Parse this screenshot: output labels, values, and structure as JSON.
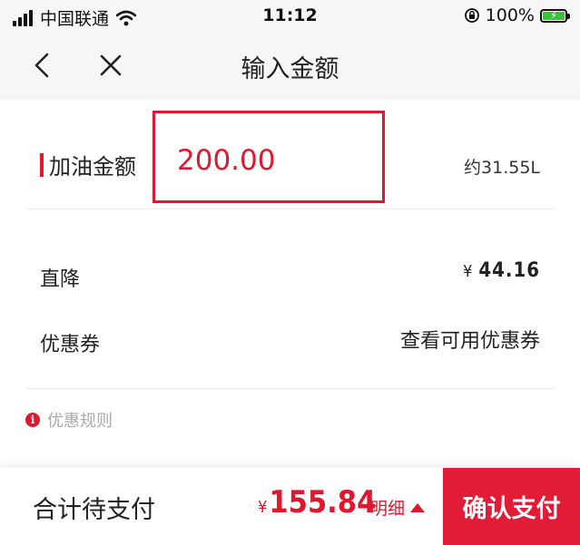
{
  "status_bar": {
    "carrier": "中国联通",
    "time": "11:12",
    "battery_percent": "100%",
    "battery_level": 1.0,
    "icons": [
      "signal-icon",
      "wifi-icon",
      "orientation-lock-icon",
      "battery-charging-icon"
    ]
  },
  "nav": {
    "title": "输入金额",
    "back_icon": "chevron-left-icon",
    "close_icon": "close-icon"
  },
  "amount": {
    "label": "加油金额",
    "value": "200.00",
    "litres": "约31.55L"
  },
  "discount": {
    "label": "直降",
    "currency": "¥",
    "value": "44.16"
  },
  "coupon": {
    "label": "优惠券",
    "action": "查看可用优惠券"
  },
  "rules": {
    "label": "优惠规则",
    "icon": "info-icon"
  },
  "footer": {
    "total_label": "合计待支付",
    "currency": "¥",
    "total_value": "155.84",
    "detail_label": "明细",
    "detail_icon": "caret-up-icon",
    "confirm_label": "确认支付"
  },
  "colors": {
    "accent": "#e0182f",
    "confirm_bg": "#e21b36",
    "battery_green": "#37c23a",
    "header_bg": "#f6f6f6"
  }
}
